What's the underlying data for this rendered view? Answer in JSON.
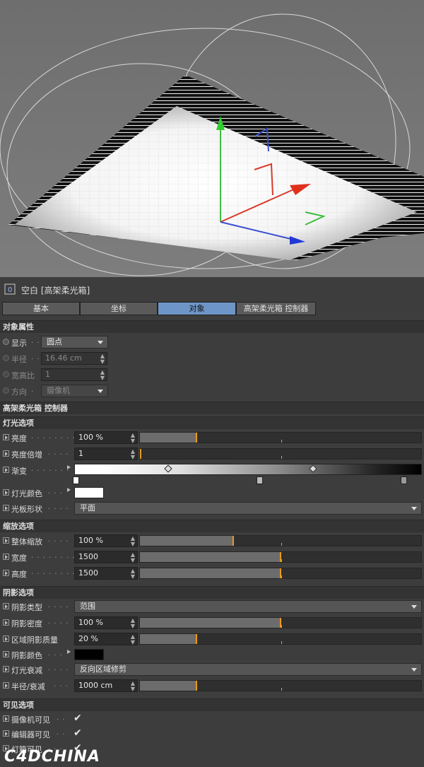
{
  "object": {
    "title": "空白 [高架柔光箱]",
    "icon": "null-object-icon"
  },
  "tabs": [
    {
      "label": "基本",
      "active": false
    },
    {
      "label": "坐标",
      "active": false
    },
    {
      "label": "对象",
      "active": true
    },
    {
      "label": "高架柔光箱 控制器",
      "active": false
    }
  ],
  "object_props": {
    "section": "对象属性",
    "display": {
      "label": "显示",
      "value": "圆点"
    },
    "radius": {
      "label": "半径",
      "value": "16.46 cm"
    },
    "aspect": {
      "label": "宽高比",
      "value": "1"
    },
    "orientation": {
      "label": "方向",
      "value": "摄像机"
    }
  },
  "controller_header": "高架柔光箱 控制器",
  "light": {
    "section": "灯光选项",
    "brightness": {
      "label": "亮度",
      "value": "100 %",
      "level": 0.2
    },
    "multiplier": {
      "label": "亮度倍增",
      "value": "1",
      "level": 0.0
    },
    "gradient": {
      "label": "渐变"
    },
    "color": {
      "label": "灯光颜色",
      "color": "#ffffff"
    },
    "shape": {
      "label": "光板形状",
      "value": "平面"
    }
  },
  "scale": {
    "section": "缩放选项",
    "overall": {
      "label": "整体缩放",
      "value": "100 %",
      "level": 0.33
    },
    "width": {
      "label": "宽度",
      "value": "1500",
      "level": 0.5
    },
    "height": {
      "label": "高度",
      "value": "1500",
      "level": 0.5
    }
  },
  "shadow": {
    "section": "阴影选项",
    "type": {
      "label": "阴影类型",
      "value": "范围"
    },
    "density": {
      "label": "阴影密度",
      "value": "100 %",
      "level": 0.5
    },
    "quality": {
      "label": "区域阴影质量",
      "value": "20 %",
      "level": 0.2
    },
    "color": {
      "label": "阴影颜色",
      "color": "#000000"
    },
    "falloff": {
      "label": "灯光衰减",
      "value": "反向区域修剪"
    },
    "radius": {
      "label": "半径/衰减",
      "value": "1000 cm",
      "level": 0.2
    }
  },
  "visibility": {
    "section": "可见选项",
    "camera": {
      "label": "摄像机可见",
      "checked": true
    },
    "editor": {
      "label": "编辑器可见",
      "checked": true
    },
    "lightbox": {
      "label": "灯箱可见",
      "checked": true
    }
  },
  "watermark": "C4DCHINA",
  "colors": {
    "accent": "#e89a1d",
    "active_tab": "#6e95c7"
  }
}
